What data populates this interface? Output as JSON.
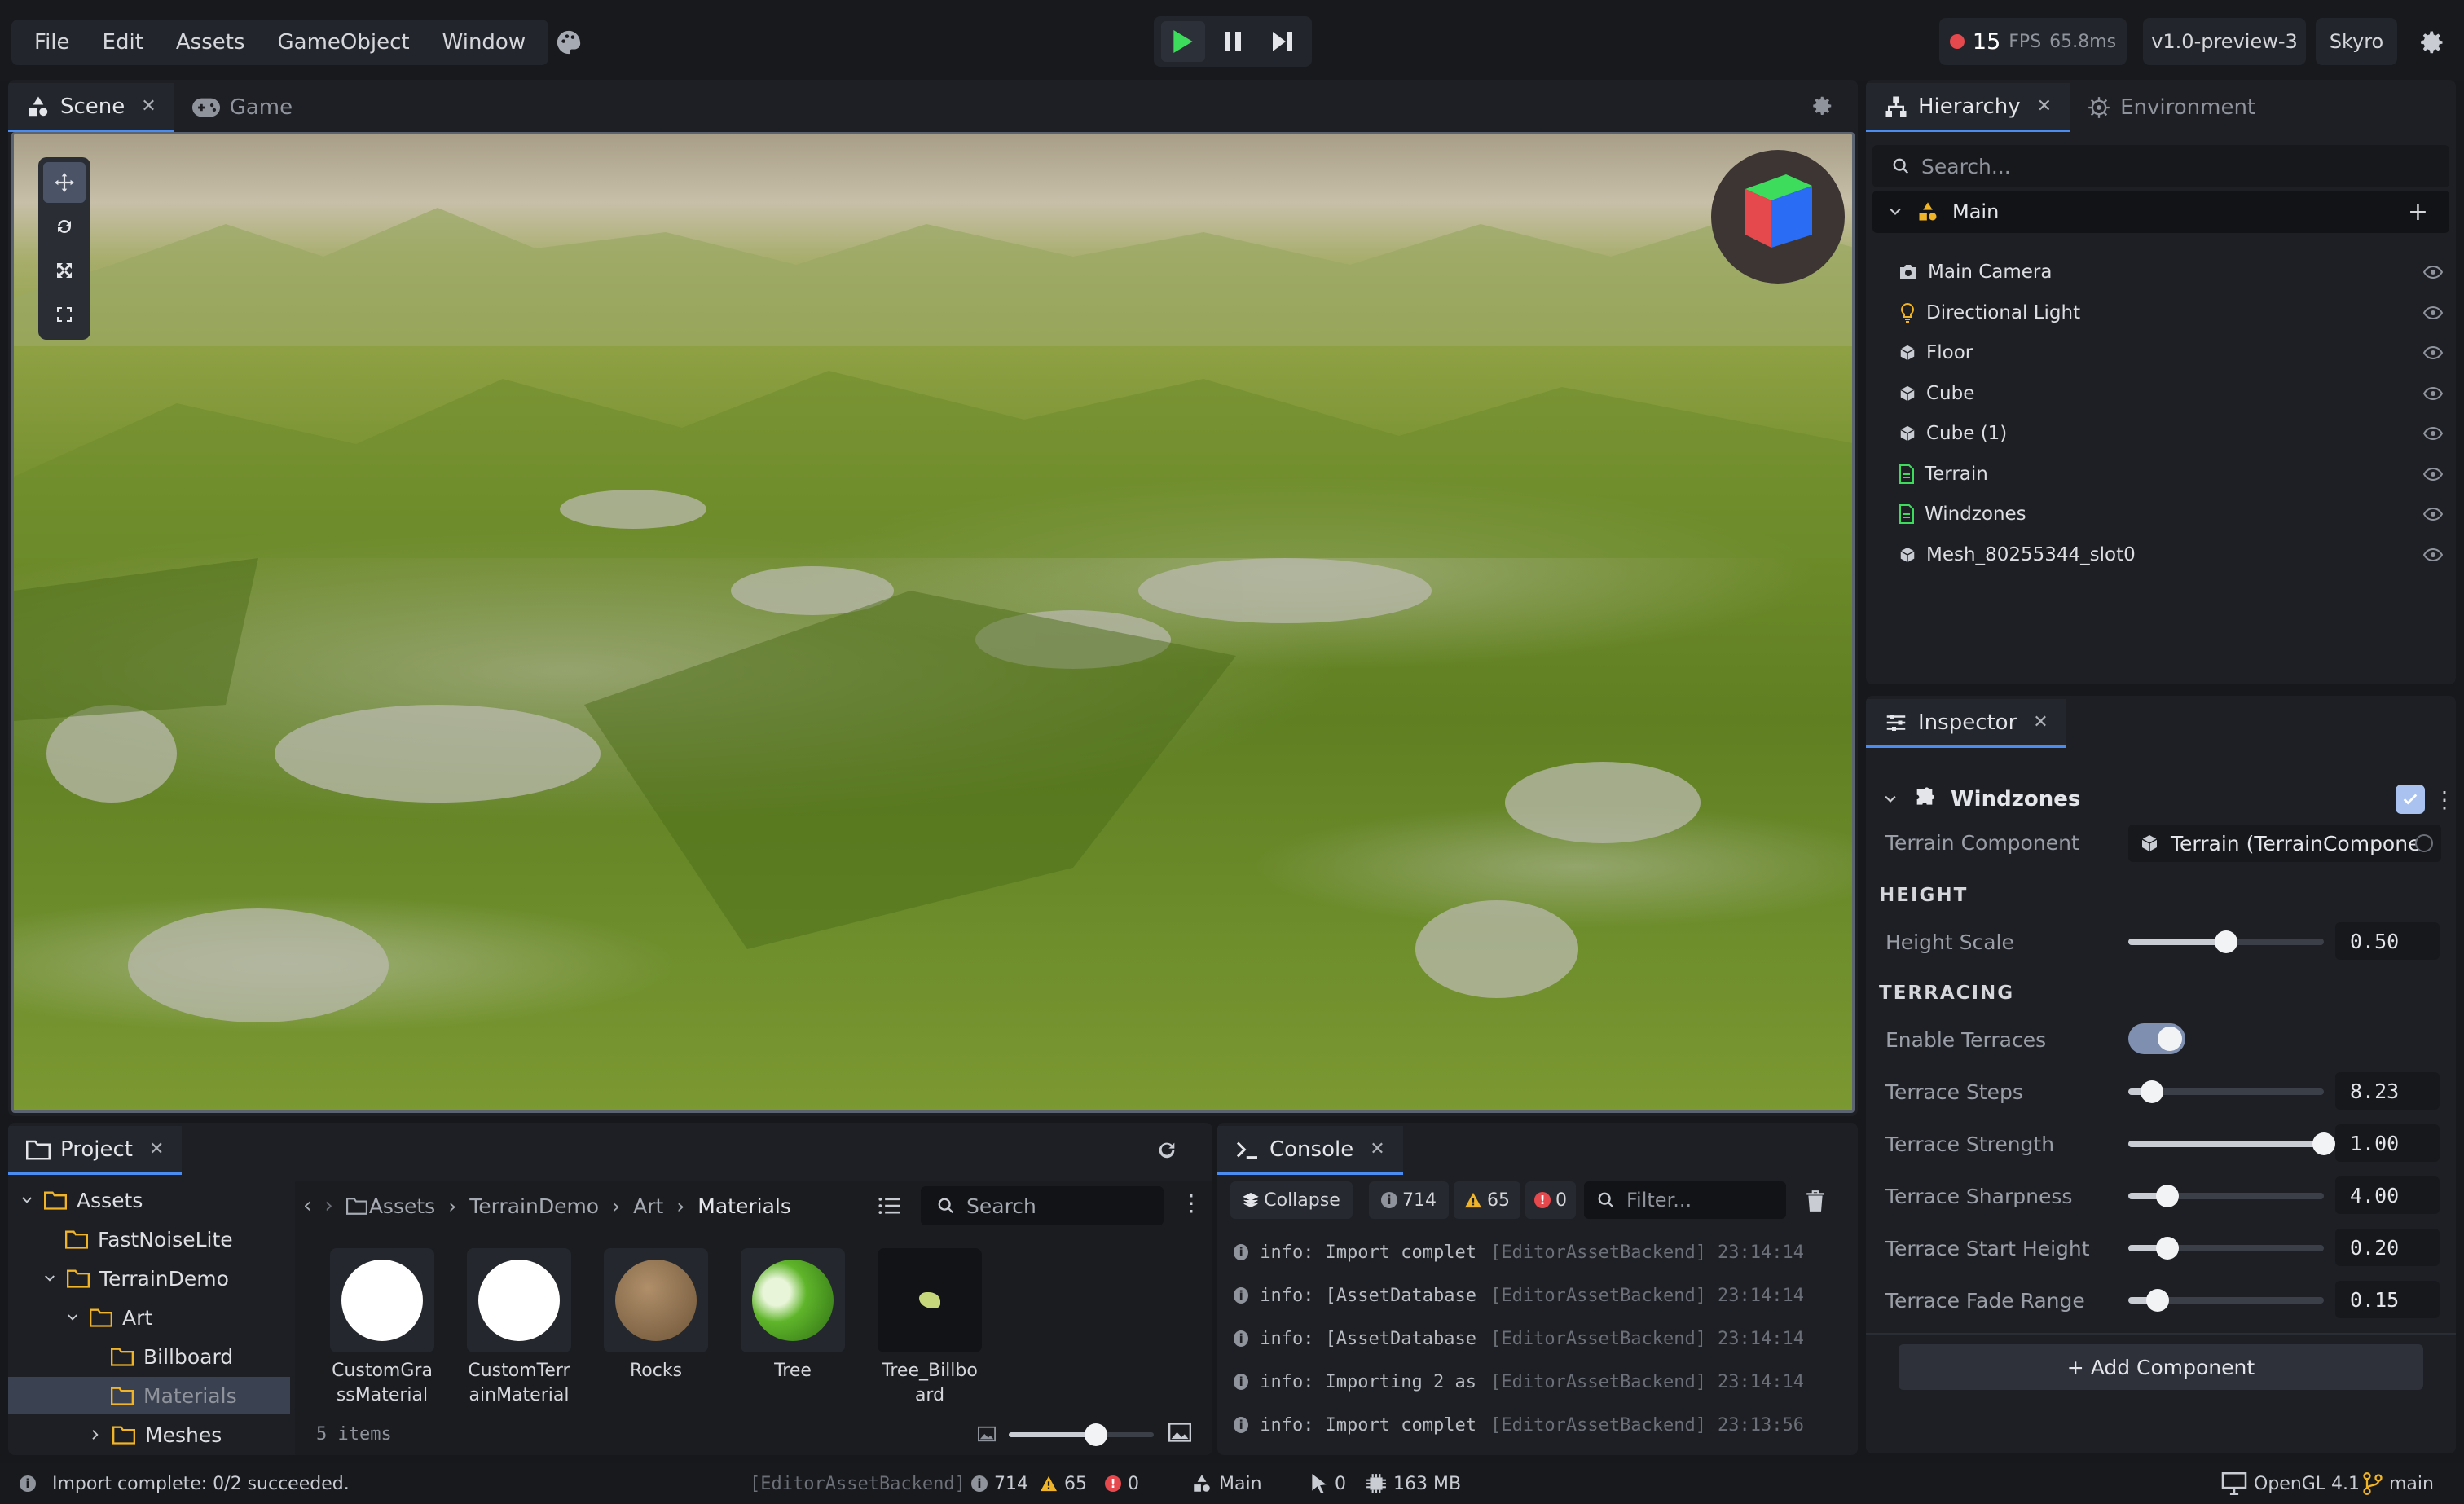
{
  "menu": {
    "file": "File",
    "edit": "Edit",
    "assets": "Assets",
    "gameobject": "GameObject",
    "window": "Window"
  },
  "stats": {
    "fps_value": "15",
    "fps_label": "FPS",
    "frame_time": "65.8ms",
    "version": "v1.0-preview-3",
    "user": "Skyro"
  },
  "scene_tabs": {
    "scene": "Scene",
    "game": "Game",
    "close": "✕"
  },
  "hierarchy": {
    "tab_hierarchy": "Hierarchy",
    "tab_environment": "Environment",
    "close": "✕",
    "search_placeholder": "Search...",
    "root": "Main",
    "add": "+",
    "items": [
      {
        "label": "Main Camera",
        "icon": "camera-icon"
      },
      {
        "label": "Directional Light",
        "icon": "light-bulb-icon"
      },
      {
        "label": "Floor",
        "icon": "cube-icon"
      },
      {
        "label": "Cube",
        "icon": "cube-icon"
      },
      {
        "label": "Cube (1)",
        "icon": "cube-icon"
      },
      {
        "label": "Terrain",
        "icon": "script-icon"
      },
      {
        "label": "Windzones",
        "icon": "script-icon"
      },
      {
        "label": "Mesh_80255344_slot0",
        "icon": "cube-icon"
      }
    ]
  },
  "inspector": {
    "tab": "Inspector",
    "close": "✕",
    "component": "Windzones",
    "terrain_component_label": "Terrain Component",
    "terrain_component_value": "Terrain (TerrainCompone",
    "section_height": "HEIGHT",
    "section_terracing": "TERRACING",
    "height_scale": {
      "label": "Height Scale",
      "value": "0.50",
      "fraction": 0.5
    },
    "enable_terraces": {
      "label": "Enable Terraces",
      "on": true
    },
    "terrace_steps": {
      "label": "Terrace Steps",
      "value": "8.23",
      "fraction": 0.12
    },
    "terrace_strength": {
      "label": "Terrace Strength",
      "value": "1.00",
      "fraction": 1.0
    },
    "terrace_sharpness": {
      "label": "Terrace Sharpness",
      "value": "4.00",
      "fraction": 0.2
    },
    "terrace_start_height": {
      "label": "Terrace Start Height",
      "value": "0.20",
      "fraction": 0.2
    },
    "terrace_fade_range": {
      "label": "Terrace Fade Range",
      "value": "0.15",
      "fraction": 0.15
    },
    "add_component": "+ Add Component"
  },
  "project": {
    "tab": "Project",
    "close": "✕",
    "tree": [
      "Assets",
      "FastNoiseLite",
      "TerrainDemo",
      "Art",
      "Billboard",
      "Materials",
      "Meshes"
    ],
    "breadcrumb": {
      "assets": "Assets",
      "terraindemo": "TerrainDemo",
      "art": "Art",
      "materials": "Materials"
    },
    "search_placeholder": "Search",
    "assets": [
      {
        "name": "CustomGra ssMaterial"
      },
      {
        "name": "CustomTerr ainMaterial"
      },
      {
        "name": "Rocks"
      },
      {
        "name": "Tree"
      },
      {
        "name": "Tree_Billbo ard"
      }
    ],
    "item_count": "5 items",
    "thumb_size_fraction": 0.6
  },
  "console": {
    "tab": "Console",
    "close": "✕",
    "collapse": "Collapse",
    "info_count": "714",
    "warn_count": "65",
    "error_count": "0",
    "filter_placeholder": "Filter...",
    "rows": [
      {
        "level": "info:",
        "msg": "Import complet",
        "src": "[EditorAssetBackend]",
        "time": "23:14:14"
      },
      {
        "level": "info:",
        "msg": "[AssetDatabase",
        "src": "[EditorAssetBackend]",
        "time": "23:14:14"
      },
      {
        "level": "info:",
        "msg": "[AssetDatabase",
        "src": "[EditorAssetBackend]",
        "time": "23:14:14"
      },
      {
        "level": "info:",
        "msg": "Importing 2 as",
        "src": "[EditorAssetBackend]",
        "time": "23:14:14"
      },
      {
        "level": "info:",
        "msg": "Import complet",
        "src": "[EditorAssetBackend]",
        "time": "23:13:56"
      }
    ]
  },
  "statusbar": {
    "message": "Import complete: 0/2 succeeded.",
    "source": "[EditorAssetBackend]",
    "info": "714",
    "warn": "65",
    "error": "0",
    "scene": "Main",
    "selected": "0",
    "memory": "163 MB",
    "renderer": "OpenGL 4.1",
    "branch": "main"
  },
  "colors": {
    "accent": "#4a8cf0",
    "play": "#3ddc5c",
    "warning": "#f0b429",
    "error": "#e5484d",
    "background": "#16181c",
    "panel": "#1d1f24"
  }
}
